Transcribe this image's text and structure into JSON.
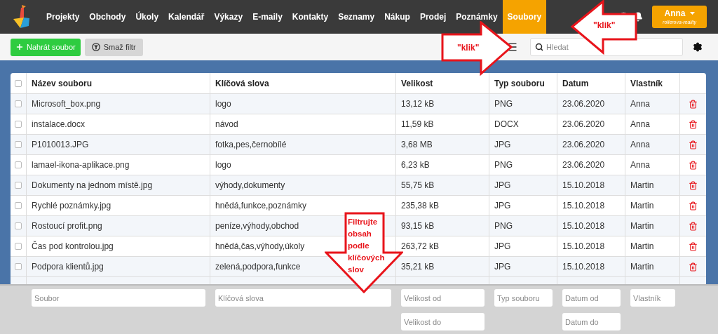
{
  "nav": {
    "items": [
      {
        "label": "Projekty",
        "selected": false
      },
      {
        "label": "Obchody",
        "selected": false
      },
      {
        "label": "Úkoly",
        "selected": false
      },
      {
        "label": "Kalendář",
        "selected": false
      },
      {
        "label": "Výkazy",
        "selected": false
      },
      {
        "label": "E-maily",
        "selected": false
      },
      {
        "label": "Kontakty",
        "selected": false
      },
      {
        "label": "Seznamy",
        "selected": false
      },
      {
        "label": "Nákup",
        "selected": false
      },
      {
        "label": "Prodej",
        "selected": false
      },
      {
        "label": "Poznámky",
        "selected": false
      },
      {
        "label": "Soubory",
        "selected": true
      }
    ],
    "user": {
      "name": "Anna",
      "company": "rollerova-reality"
    }
  },
  "toolbar": {
    "upload_button": "Nahrát soubor",
    "clear_filter_button": "Smaž filtr",
    "search": {
      "placeholder": "Hledat"
    }
  },
  "table": {
    "all_checked": false,
    "columns": [
      "Název souboru",
      "Klíčová slova",
      "Velikost",
      "Typ souboru",
      "Datum",
      "Vlastník"
    ],
    "rows": [
      {
        "checked": false,
        "cells": [
          "Microsoft_box.png",
          "logo",
          "13,12 kB",
          "PNG",
          "23.06.2020",
          "Anna"
        ]
      },
      {
        "checked": false,
        "cells": [
          "instalace.docx",
          "návod",
          "11,59 kB",
          "DOCX",
          "23.06.2020",
          "Anna"
        ]
      },
      {
        "checked": false,
        "cells": [
          "P1010013.JPG",
          "fotka,pes,černobílé",
          "3,68 MB",
          "JPG",
          "23.06.2020",
          "Anna"
        ]
      },
      {
        "checked": false,
        "cells": [
          "lamael-ikona-aplikace.png",
          "logo",
          "6,23 kB",
          "PNG",
          "23.06.2020",
          "Anna"
        ]
      },
      {
        "checked": false,
        "cells": [
          "Dokumenty na jednom místě.jpg",
          "výhody,dokumenty",
          "55,75 kB",
          "JPG",
          "15.10.2018",
          "Martin"
        ]
      },
      {
        "checked": false,
        "cells": [
          "Rychlé poznámky.jpg",
          "hnědá,funkce,poznámky",
          "235,38 kB",
          "JPG",
          "15.10.2018",
          "Martin"
        ]
      },
      {
        "checked": false,
        "cells": [
          "Rostoucí profit.png",
          "peníze,výhody,obchod",
          "93,15 kB",
          "PNG",
          "15.10.2018",
          "Martin"
        ]
      },
      {
        "checked": false,
        "cells": [
          "Čas pod kontrolou.jpg",
          "hnědá,čas,výhody,úkoly",
          "263,72 kB",
          "JPG",
          "15.10.2018",
          "Martin"
        ]
      },
      {
        "checked": false,
        "cells": [
          "Podpora klientů.jpg",
          "zelená,podpora,funkce",
          "35,21 kB",
          "JPG",
          "15.10.2018",
          "Martin"
        ]
      }
    ]
  },
  "filters": [
    {
      "fields": [
        {
          "placeholder": "Soubor"
        }
      ]
    },
    {
      "fields": [
        {
          "placeholder": "Klíčová slova"
        }
      ]
    },
    {
      "fields": [
        {
          "placeholder": "Velikost od"
        },
        {
          "placeholder": "Velikost do"
        }
      ]
    },
    {
      "fields": [
        {
          "placeholder": "Typ souboru"
        }
      ]
    },
    {
      "fields": [
        {
          "placeholder": "Datum od"
        },
        {
          "placeholder": "Datum do"
        }
      ]
    },
    {
      "fields": [
        {
          "placeholder": "Vlastník"
        }
      ]
    }
  ],
  "annotations": [
    {
      "kind": "left",
      "text": "\"klik\""
    },
    {
      "kind": "right",
      "text": "\"klik\""
    },
    {
      "kind": "down",
      "text": "Filtrujte obsah podle klíčových slov"
    }
  ]
}
